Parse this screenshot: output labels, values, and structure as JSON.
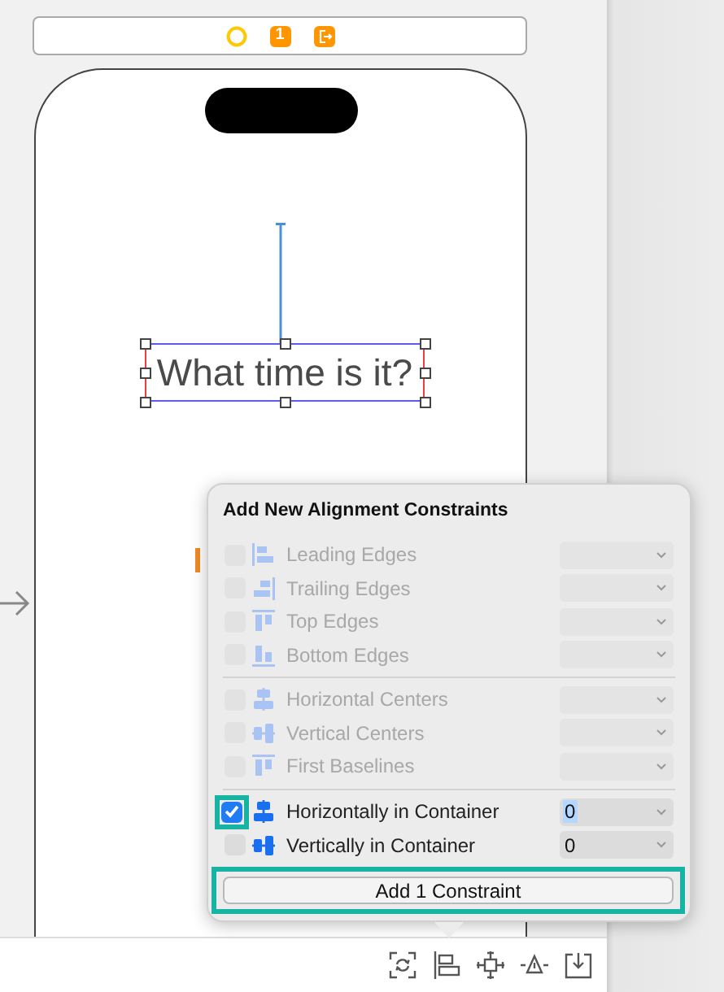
{
  "scene_bar": {
    "first_responder_glyph": "1"
  },
  "canvas": {
    "label": {
      "text": "What time is it?",
      "selected": true
    }
  },
  "popover": {
    "title": "Add New Alignment Constraints",
    "sections": [
      {
        "rows": [
          {
            "label": "Leading Edges",
            "checked": false,
            "disabled": true,
            "highlighted": false
          },
          {
            "label": "Trailing Edges",
            "checked": false,
            "disabled": true,
            "highlighted": false
          },
          {
            "label": "Top Edges",
            "checked": false,
            "disabled": true,
            "highlighted": false
          },
          {
            "label": "Bottom Edges",
            "checked": false,
            "disabled": true,
            "highlighted": false
          }
        ]
      },
      {
        "rows": [
          {
            "label": "Horizontal Centers",
            "checked": false,
            "disabled": true,
            "highlighted": false
          },
          {
            "label": "Vertical Centers",
            "checked": false,
            "disabled": true,
            "highlighted": false
          },
          {
            "label": "First Baselines",
            "checked": false,
            "disabled": true,
            "highlighted": false
          }
        ]
      },
      {
        "rows": [
          {
            "label": "Horizontally in Container",
            "checked": true,
            "disabled": false,
            "highlighted": true,
            "value": "0",
            "value_selected": true
          },
          {
            "label": "Vertically in Container",
            "checked": false,
            "disabled": false,
            "highlighted": false,
            "value": "0",
            "value_selected": false
          }
        ]
      }
    ],
    "button": {
      "label": "Add 1 Constraint",
      "highlighted": true
    }
  }
}
